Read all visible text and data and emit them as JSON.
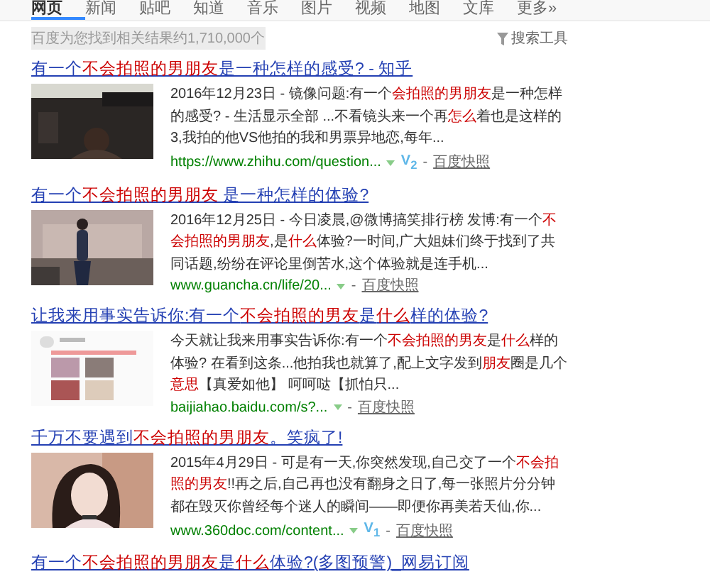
{
  "tabs": [
    {
      "label": "网页",
      "selected": true
    },
    {
      "label": "新闻",
      "selected": false
    },
    {
      "label": "贴吧",
      "selected": false
    },
    {
      "label": "知道",
      "selected": false
    },
    {
      "label": "音乐",
      "selected": false
    },
    {
      "label": "图片",
      "selected": false
    },
    {
      "label": "视频",
      "selected": false
    },
    {
      "label": "地图",
      "selected": false
    },
    {
      "label": "文库",
      "selected": false
    },
    {
      "label": "更多»",
      "selected": false
    }
  ],
  "result_count": "百度为您找到相关结果约1,710,000个",
  "search_tools": "搜索工具",
  "results": [
    {
      "title": [
        {
          "text": "有一个",
          "hl": false
        },
        {
          "text": "不会拍照的男朋友",
          "hl": true
        },
        {
          "text": "是一种怎样的感受? - 知乎",
          "hl": false
        }
      ],
      "thumbnail": {
        "kind": "picture"
      },
      "snippet": [
        {
          "text": "2016年12月23日 - 镜像问题:有一个",
          "hl": false
        },
        {
          "text": "会拍照的男朋友",
          "hl": true
        },
        {
          "text": "是一种怎样的感受? - 生活显示全部 ...不看镜头来一个再",
          "hl": false
        },
        {
          "text": "怎么",
          "hl": true
        },
        {
          "text": "着也是这样的3,我拍的他VS他拍的我和男票异地恋,每年...",
          "hl": false
        }
      ],
      "url": "https://www.zhihu.com/question...",
      "vip": "V$_{2}$",
      "sep": "-",
      "snapshot": "百度快照"
    },
    {
      "title": [
        {
          "text": "有一个",
          "hl": false
        },
        {
          "text": "不会拍照的男朋友",
          "hl": true
        },
        {
          "text": " 是一种怎样的体验?",
          "hl": false
        }
      ],
      "thumbnail": {
        "kind": "picture"
      },
      "snippet": [
        {
          "text": "2016年12月25日 - 今日凌晨,@微博搞笑排行榜 发博:有一个",
          "hl": false
        },
        {
          "text": "不会拍照的男朋友",
          "hl": true
        },
        {
          "text": ",是",
          "hl": false
        },
        {
          "text": "什么",
          "hl": true
        },
        {
          "text": "体验?一时间,广大姐妹们终于找到了共同话题,纷纷在评论里倒苦水,这个体验就是连手机...",
          "hl": false
        }
      ],
      "url": "www.guancha.cn/life/20...",
      "sep": "-",
      "snapshot": "百度快照"
    },
    {
      "title": [
        {
          "text": "让我来用事实告诉你:有一个",
          "hl": false
        },
        {
          "text": "不会拍照的男友",
          "hl": true
        },
        {
          "text": "是",
          "hl": false
        },
        {
          "text": "什么",
          "hl": true
        },
        {
          "text": "样的体验?",
          "hl": false
        }
      ],
      "thumbnail": {
        "kind": "picture"
      },
      "snippet": [
        {
          "text": "今天就让我来用事实告诉你:有一个",
          "hl": false
        },
        {
          "text": "不会拍照的男友",
          "hl": true
        },
        {
          "text": "是",
          "hl": false
        },
        {
          "text": "什么",
          "hl": true
        },
        {
          "text": "样的体验? 在看到这条...他拍我也就算了,配上文字发到",
          "hl": false
        },
        {
          "text": "朋友",
          "hl": true
        },
        {
          "text": "圈是几个",
          "hl": false
        },
        {
          "text": "意思",
          "hl": true
        },
        {
          "text": "【真爱如他】 呵呵哒【抓怕只...",
          "hl": false
        }
      ],
      "url": "baijiahao.baidu.com/s?...",
      "sep": "-",
      "snapshot": "百度快照"
    },
    {
      "title": [
        {
          "text": "千万不要遇到",
          "hl": false
        },
        {
          "text": "不会拍照的男朋友",
          "hl": true
        },
        {
          "text": "。笑疯了!",
          "hl": false
        }
      ],
      "thumbnail": {
        "kind": "picture"
      },
      "snippet": [
        {
          "text": "2015年4月29日 - 可是有一天,你突然发现,自己交了一个",
          "hl": false
        },
        {
          "text": "不会拍照的男友",
          "hl": true
        },
        {
          "text": "!!再之后,自己再也没有翻身之日了,每一张照片分分钟都在毁灭你曾经每个迷人的瞬间——即便你再美若天仙,你...",
          "hl": false
        }
      ],
      "url": "www.360doc.com/content...",
      "vip": "V$_{1}$",
      "sep": "-",
      "snapshot": "百度快照"
    },
    {
      "title": [
        {
          "text": "有一个",
          "hl": false
        },
        {
          "text": "不会拍照的男朋友",
          "hl": true
        },
        {
          "text": "是",
          "hl": false
        },
        {
          "text": "什么",
          "hl": true
        },
        {
          "text": "体验?(多图预警)_网易订阅",
          "hl": false
        }
      ]
    }
  ]
}
